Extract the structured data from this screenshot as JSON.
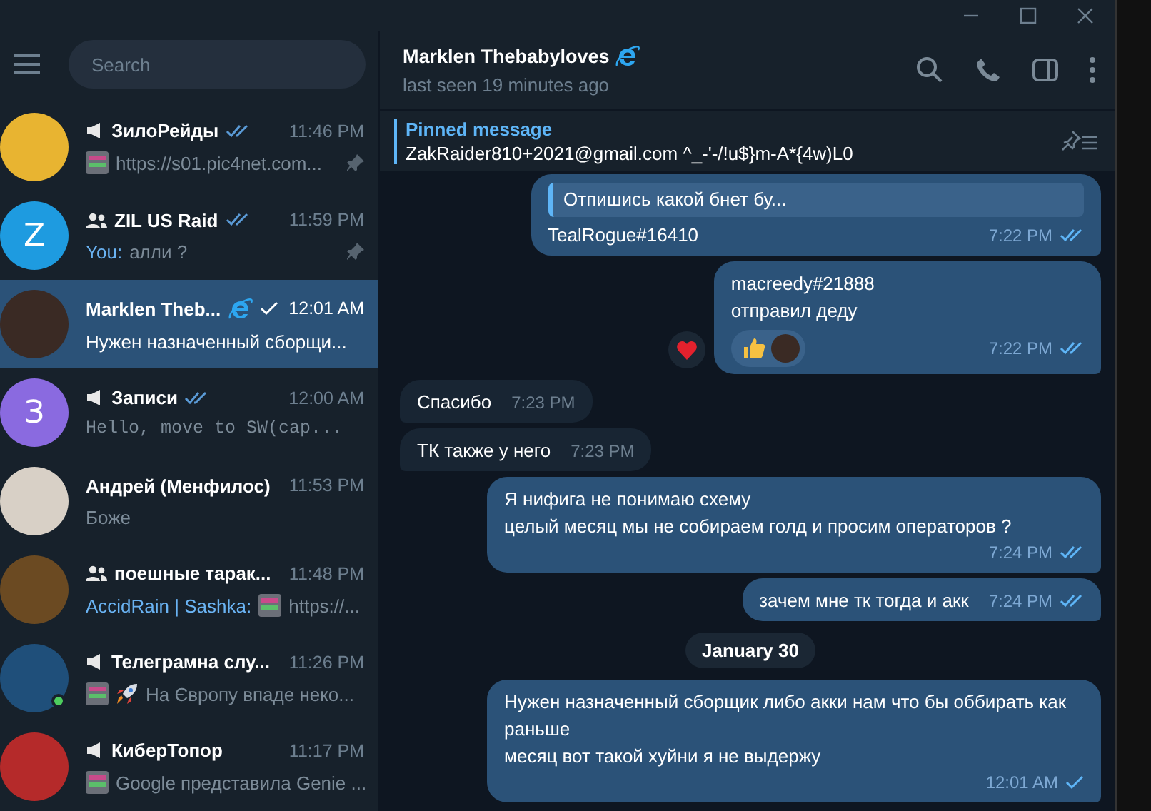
{
  "window": {
    "controls": [
      {
        "kind": "minimize"
      },
      {
        "kind": "maximize"
      },
      {
        "kind": "close"
      }
    ]
  },
  "sidebar": {
    "search": {
      "placeholder": "Search"
    },
    "chats": [
      {
        "kind": "channel",
        "name": "ЗилоРейды",
        "time": "11:46 PM",
        "read": true,
        "avatar": {
          "kind": "photo",
          "color": "#e8b431"
        },
        "media": [
          {
            "kind": "photo"
          }
        ],
        "preview": "https://s01.pic4net.com...",
        "pinned": true,
        "selected": false
      },
      {
        "kind": "group",
        "name": "ZIL US Raid",
        "time": "11:59 PM",
        "read": true,
        "avatar": {
          "kind": "letter",
          "letter": "Z",
          "color": "#1e9be0"
        },
        "sender": "You:",
        "preview": "алли ?",
        "pinned": true,
        "selected": false
      },
      {
        "kind": "user",
        "name": "Marklen Theb...",
        "emoji_status": true,
        "time": "12:01 AM",
        "read": false,
        "avatar": {
          "kind": "photo",
          "color": "#3a2a24"
        },
        "preview": "Нужен назначенный сборщи...",
        "pinned": false,
        "selected": true
      },
      {
        "kind": "channel",
        "name": "Записи",
        "time": "12:00 AM",
        "read": true,
        "avatar": {
          "kind": "letter",
          "letter": "З",
          "color": "#8a6ae0"
        },
        "preview": "Hello, move to SW(cap...",
        "mono": true,
        "pinned": false,
        "selected": false
      },
      {
        "kind": "user",
        "name": "Андрей (Менфилос)",
        "time": "11:53 PM",
        "avatar": {
          "kind": "photo",
          "color": "#d8d0c6"
        },
        "preview": "Боже",
        "pinned": false,
        "selected": false
      },
      {
        "kind": "group",
        "name": "поешные тарак...",
        "time": "11:48 PM",
        "avatar": {
          "kind": "photo",
          "color": "#6b4a22"
        },
        "sender": "AccidRain | Sashka:",
        "media": [
          {
            "kind": "photo"
          }
        ],
        "preview": "https://...",
        "pinned": false,
        "selected": false
      },
      {
        "kind": "channel",
        "name": "Телеграмна слу...",
        "time": "11:26 PM",
        "avatar": {
          "kind": "photo",
          "color": "#1f4f7a",
          "online": true
        },
        "media": [
          {
            "kind": "photo"
          },
          {
            "kind": "rocket"
          }
        ],
        "preview": "На Європу впаде неко...",
        "pinned": false,
        "selected": false
      },
      {
        "kind": "channel",
        "name": "КиберТопор",
        "time": "11:17 PM",
        "avatar": {
          "kind": "photo",
          "color": "#b52a2a"
        },
        "media": [
          {
            "kind": "photo"
          }
        ],
        "preview": "Google представила Genie ...",
        "pinned": false,
        "selected": false
      }
    ]
  },
  "chat": {
    "title": "Marklen Thebabyloves",
    "emoji_status": true,
    "subtitle": "last seen 19 minutes ago",
    "pinned": {
      "label": "Pinned message",
      "text": "ZakRaider810+2021@gmail.com ^_-'-/!u$}m-A*{4w)L0"
    },
    "messages": [
      {
        "kind": "message",
        "outgoing": true,
        "reply": "Отпишись какой бнет бу...",
        "text": "TealRogue#16410",
        "time": "7:22 PM",
        "read": true
      },
      {
        "kind": "message",
        "outgoing": true,
        "text": "macreedy#21888\nотправил деду",
        "time": "7:22 PM",
        "read": true,
        "reactions": [
          {
            "kind": "thumbs_up"
          },
          {
            "kind": "avatar"
          }
        ],
        "side_reaction": {
          "kind": "heart"
        }
      },
      {
        "kind": "message",
        "outgoing": false,
        "text": "Спасибо",
        "time": "7:23 PM"
      },
      {
        "kind": "message",
        "outgoing": false,
        "text": "ТК также у него",
        "time": "7:23 PM"
      },
      {
        "kind": "message",
        "outgoing": true,
        "text": "Я нифига не понимаю схему\nцелый месяц мы не собираем голд и просим операторов ?",
        "time": "7:24 PM",
        "read": true
      },
      {
        "kind": "message",
        "outgoing": true,
        "text": "зачем мне тк тогда и акк",
        "time": "7:24 PM",
        "read": true
      },
      {
        "kind": "date",
        "text": "January 30"
      },
      {
        "kind": "message",
        "outgoing": true,
        "text": "Нужен назначенный сборщик либо акки нам что бы оббирать как раньше\nмесяц вот такой хуйни я не выдержу",
        "time": "12:01 AM",
        "read": false
      }
    ]
  }
}
